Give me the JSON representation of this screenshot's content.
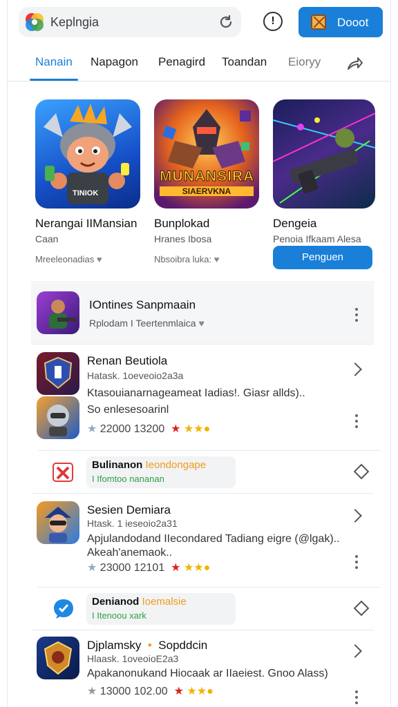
{
  "header": {
    "search_text": "Keplngia",
    "boost_label": "Dooot"
  },
  "tabs": [
    {
      "label": "Nanain"
    },
    {
      "label": "Napagon"
    },
    {
      "label": "Penagird"
    },
    {
      "label": "Toandan"
    },
    {
      "label": "Eioryy"
    }
  ],
  "featured": [
    {
      "title": "Nerangai IIMansian",
      "subtitle": "Caan",
      "meta": "Mreeleonadias",
      "art_text": "TINIOK"
    },
    {
      "title": "Bunplokad",
      "subtitle": "Hranes Ibosa",
      "meta": "Nbsoibra luka:",
      "art_text": "MUNANSIRA",
      "art_sub": "SIAERVKNA"
    },
    {
      "title": "Dengeia",
      "subtitle": "Penoia Ifkaam Alesa",
      "button": "Penguen"
    }
  ],
  "list": {
    "header_item": {
      "title": "IOntines Sanpmaain",
      "subtitle": "Rplodam I Teertenmlaica"
    },
    "item1": {
      "title": "Renan Beutiola",
      "subtitle": "Hatask. 1oeveoio2a3a",
      "desc": "Ktasouianarnageameat Iadias!. Giasr allds)..",
      "desc2": "So enlesesoarinl",
      "rating": "22000 13200"
    },
    "promo1": {
      "title_a": "Bulinanon",
      "title_b": "Ieondongape",
      "subtitle": "I Ifomtoo nananan"
    },
    "item2": {
      "title": "Sesien Demiara",
      "subtitle": "Htask. 1 ieseoio2a31",
      "desc": "Apjulandodand IIecondared Tadiang eigre (@lgak)..",
      "desc2": "Akeah'anemaok..",
      "rating": "23000 12101"
    },
    "promo2": {
      "title_a": "Denianod",
      "title_b": "Ioemalsie",
      "subtitle": "I Itenoou xark"
    },
    "item3": {
      "title": "Djplamsky",
      "title_b": "Sopddcin",
      "subtitle": "Hlaask. 1oveoioE2a3",
      "desc": "Apakanonukand Hiocaak ar IIaeiest. Gnoo Alass)",
      "rating": "13000 102.00"
    }
  },
  "colors": {
    "accent": "#1a7fd8",
    "promo_orange": "#f09a1a",
    "promo_green": "#2ea043"
  }
}
